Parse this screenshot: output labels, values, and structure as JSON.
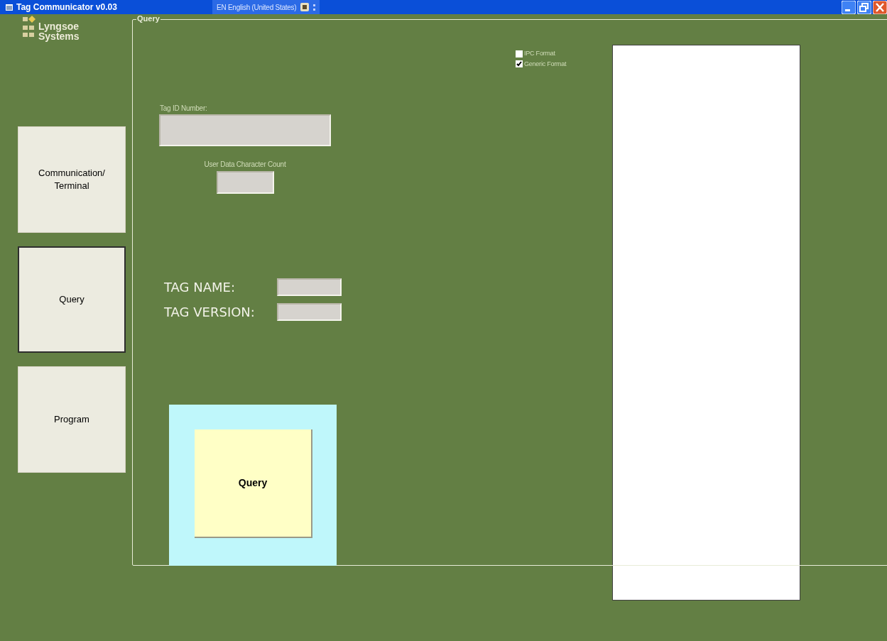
{
  "window": {
    "title": "Tag Communicator v0.03"
  },
  "language_bar": {
    "text": "EN English (United States)"
  },
  "logo": {
    "line_1": "Lyngsoe",
    "line_2": "Systems"
  },
  "nav": [
    {
      "label": "Communication/\nTerminal",
      "selected": false
    },
    {
      "label": "Query",
      "selected": true
    },
    {
      "label": "Program",
      "selected": false
    }
  ],
  "group": {
    "title": "Query"
  },
  "tag_id": {
    "label": "Tag ID Number:"
  },
  "char_count": {
    "label": "User Data Character Count"
  },
  "tag_name": {
    "label": "TAG NAME:"
  },
  "tag_version": {
    "label": "TAG VERSION:"
  },
  "formats": [
    {
      "label": "IPC Format",
      "checked": false
    },
    {
      "label": "Generic Format",
      "checked": true
    }
  ],
  "query_button": {
    "label": "Query"
  }
}
